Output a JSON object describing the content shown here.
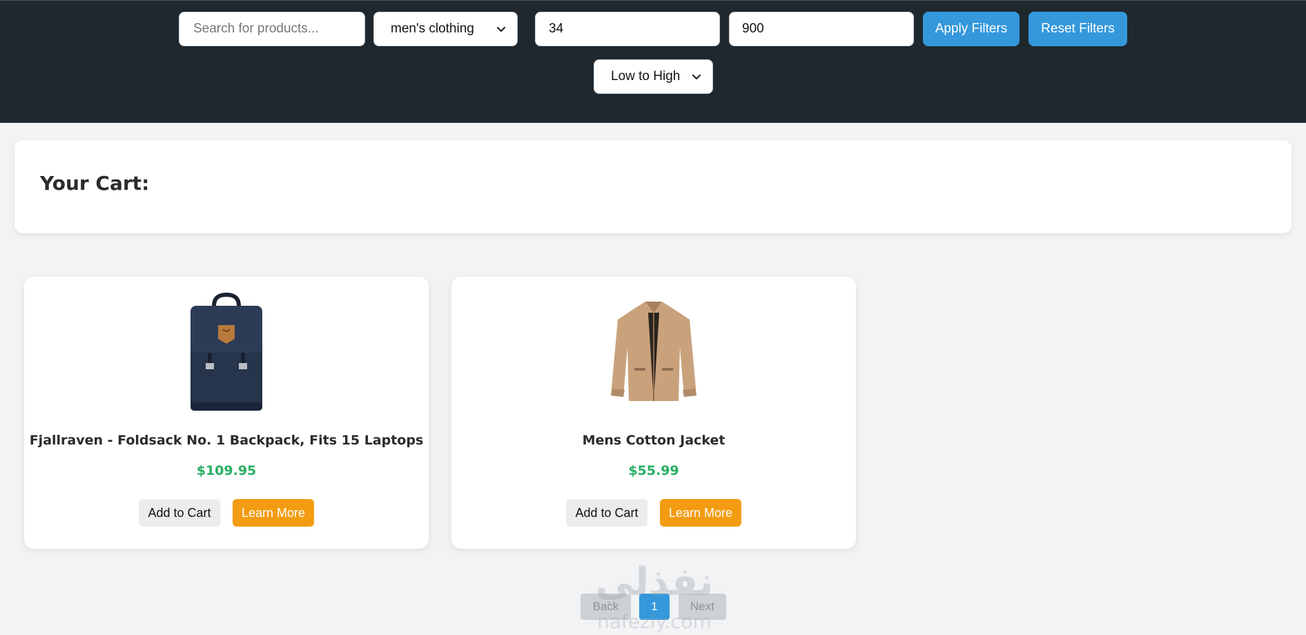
{
  "filters": {
    "search_placeholder": "Search for products...",
    "category_selected": "men's clothing",
    "min_price_value": "34",
    "max_price_value": "900",
    "apply_label": "Apply Filters",
    "reset_label": "Reset Filters",
    "sort_selected": "Low to High"
  },
  "cart": {
    "title": "Your Cart:"
  },
  "products": [
    {
      "title": "Fjallraven - Foldsack No. 1 Backpack, Fits 15 Laptops",
      "price": "$109.95",
      "add_label": "Add to Cart",
      "learn_label": "Learn More",
      "image": "backpack-image"
    },
    {
      "title": "Mens Cotton Jacket",
      "price": "$55.99",
      "add_label": "Add to Cart",
      "learn_label": "Learn More",
      "image": "jacket-image"
    }
  ],
  "pagination": {
    "back_label": "Back",
    "current_page": "1",
    "next_label": "Next"
  },
  "watermark": {
    "logo_text": "نفذلي",
    "site_text": "nafezly.com"
  },
  "colors": {
    "header_bg": "#1f282e",
    "page_bg": "#f1f3f5",
    "primary_blue": "#3498db",
    "learn_orange": "#f39c12",
    "price_green": "#27ae60"
  }
}
